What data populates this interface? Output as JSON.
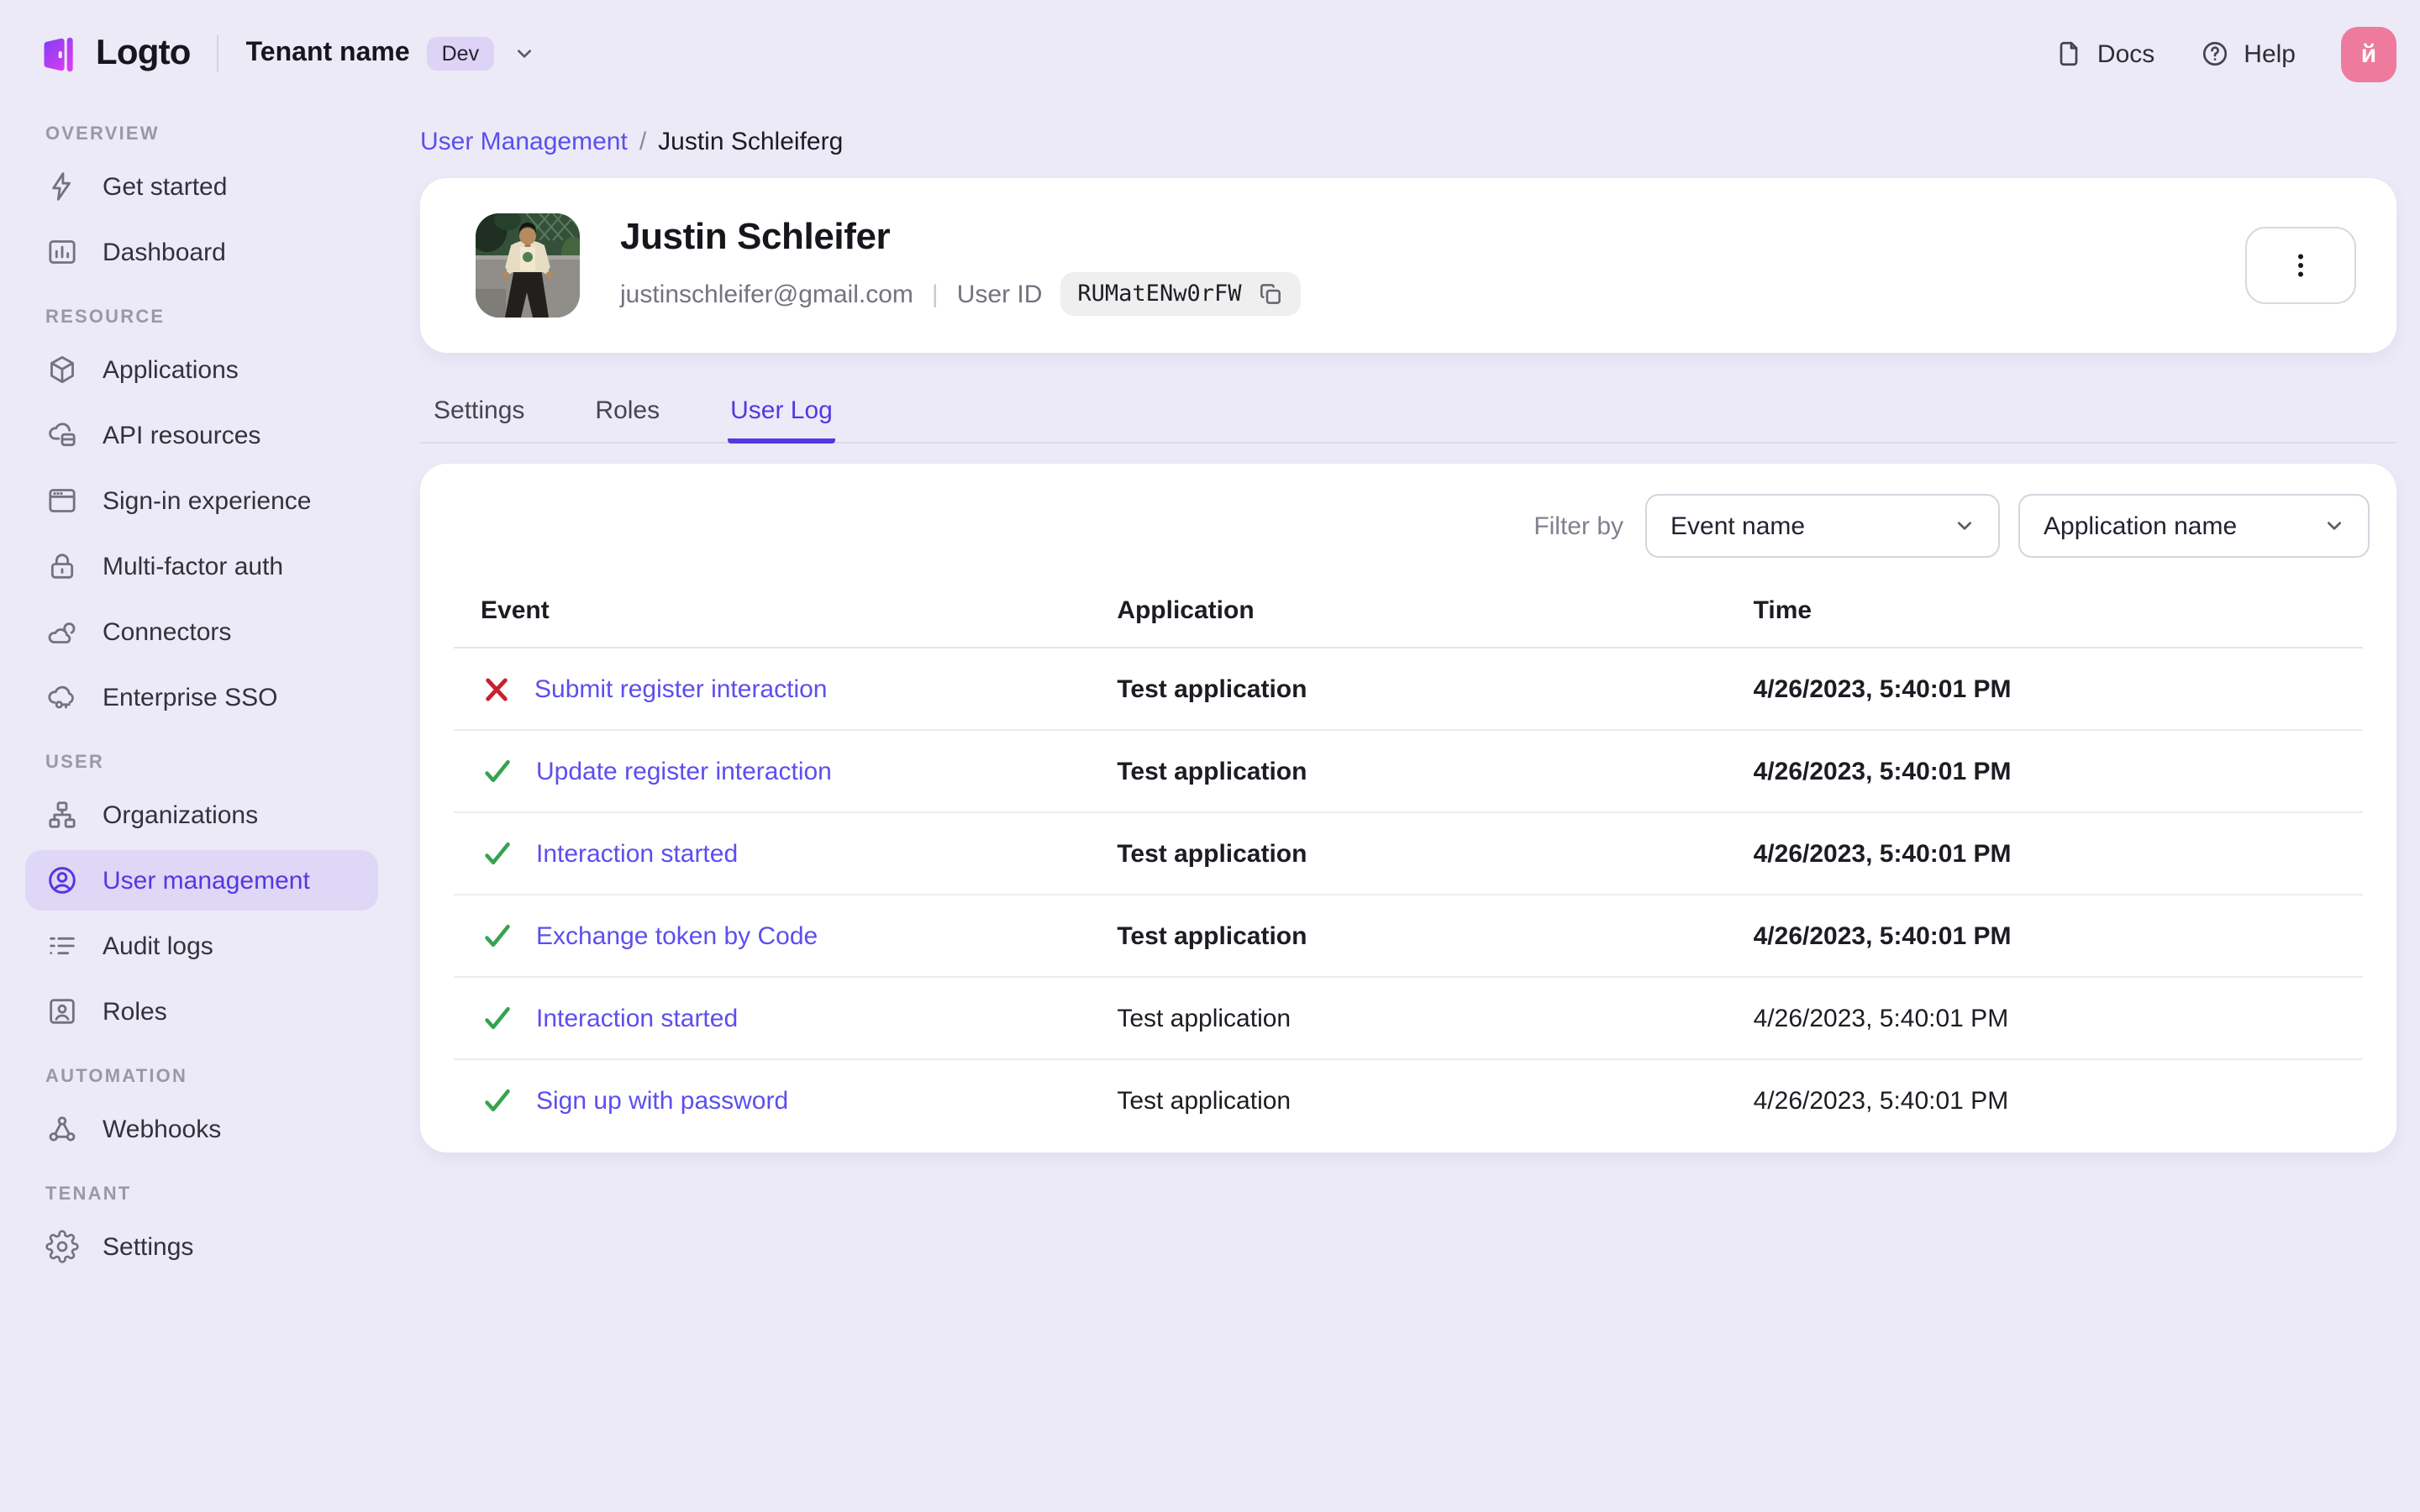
{
  "header": {
    "logo_text": "Logto",
    "tenant_name": "Tenant name",
    "tenant_badge": "Dev",
    "docs_label": "Docs",
    "help_label": "Help",
    "avatar_initial": "й"
  },
  "sidebar": {
    "sections": [
      {
        "label": "OVERVIEW",
        "items": [
          {
            "label": "Get started",
            "icon": "lightning-icon",
            "active": false
          },
          {
            "label": "Dashboard",
            "icon": "dashboard-icon",
            "active": false
          }
        ]
      },
      {
        "label": "RESOURCE",
        "items": [
          {
            "label": "Applications",
            "icon": "cube-icon",
            "active": false
          },
          {
            "label": "API resources",
            "icon": "cloud-box-icon",
            "active": false
          },
          {
            "label": "Sign-in experience",
            "icon": "browser-icon",
            "active": false
          },
          {
            "label": "Multi-factor auth",
            "icon": "lock-icon",
            "active": false
          },
          {
            "label": "Connectors",
            "icon": "clouds-icon",
            "active": false
          },
          {
            "label": "Enterprise SSO",
            "icon": "cloud-key-icon",
            "active": false
          }
        ]
      },
      {
        "label": "USER",
        "items": [
          {
            "label": "Organizations",
            "icon": "org-chart-icon",
            "active": false
          },
          {
            "label": "User management",
            "icon": "user-circle-icon",
            "active": true
          },
          {
            "label": "Audit logs",
            "icon": "list-icon",
            "active": false
          },
          {
            "label": "Roles",
            "icon": "id-card-icon",
            "active": false
          }
        ]
      },
      {
        "label": "AUTOMATION",
        "items": [
          {
            "label": "Webhooks",
            "icon": "webhook-icon",
            "active": false
          }
        ]
      },
      {
        "label": "TENANT",
        "items": [
          {
            "label": "Settings",
            "icon": "gear-icon",
            "active": false
          }
        ]
      }
    ]
  },
  "breadcrumb": {
    "parent": "User Management",
    "separator": "/",
    "current": "Justin Schleiferg"
  },
  "user_card": {
    "name": "Justin Schleifer",
    "email": "justinschleifer@gmail.com",
    "separator": "|",
    "user_id_label": "User ID",
    "user_id": "RUMatENw0rFW"
  },
  "tabs": [
    {
      "label": "Settings",
      "active": false
    },
    {
      "label": "Roles",
      "active": false
    },
    {
      "label": "User Log",
      "active": true
    }
  ],
  "log_panel": {
    "filter_label": "Filter by",
    "filters": [
      {
        "value": "Event name"
      },
      {
        "value": "Application name"
      }
    ],
    "table": {
      "columns": [
        "Event",
        "Application",
        "Time"
      ],
      "rows": [
        {
          "status": "error",
          "event": "Submit register interaction",
          "application": "Test application",
          "time": "4/26/2023, 5:40:01 PM",
          "emphasized": true
        },
        {
          "status": "success",
          "event": "Update register interaction",
          "application": "Test application",
          "time": "4/26/2023, 5:40:01 PM",
          "emphasized": true
        },
        {
          "status": "success",
          "event": "Interaction started",
          "application": "Test application",
          "time": "4/26/2023, 5:40:01 PM",
          "emphasized": true
        },
        {
          "status": "success",
          "event": "Exchange token by Code",
          "application": "Test application",
          "time": "4/26/2023, 5:40:01 PM",
          "emphasized": true
        },
        {
          "status": "success",
          "event": "Interaction started",
          "application": "Test application",
          "time": "4/26/2023, 5:40:01 PM",
          "emphasized": false
        },
        {
          "status": "success",
          "event": "Sign up with password",
          "application": "Test application",
          "time": "4/26/2023, 5:40:01 PM",
          "emphasized": false
        }
      ]
    }
  },
  "colors": {
    "page_background": "#eceaf7",
    "accent_purple": "#5537e2",
    "link_purple": "#5d4eee",
    "active_pill_lavender": "#ded8f6",
    "badge_lavender": "#dcd3f6",
    "success_green": "#36a24f",
    "error_red": "#c9202e",
    "avatar_pink": "#ee7a9e"
  }
}
